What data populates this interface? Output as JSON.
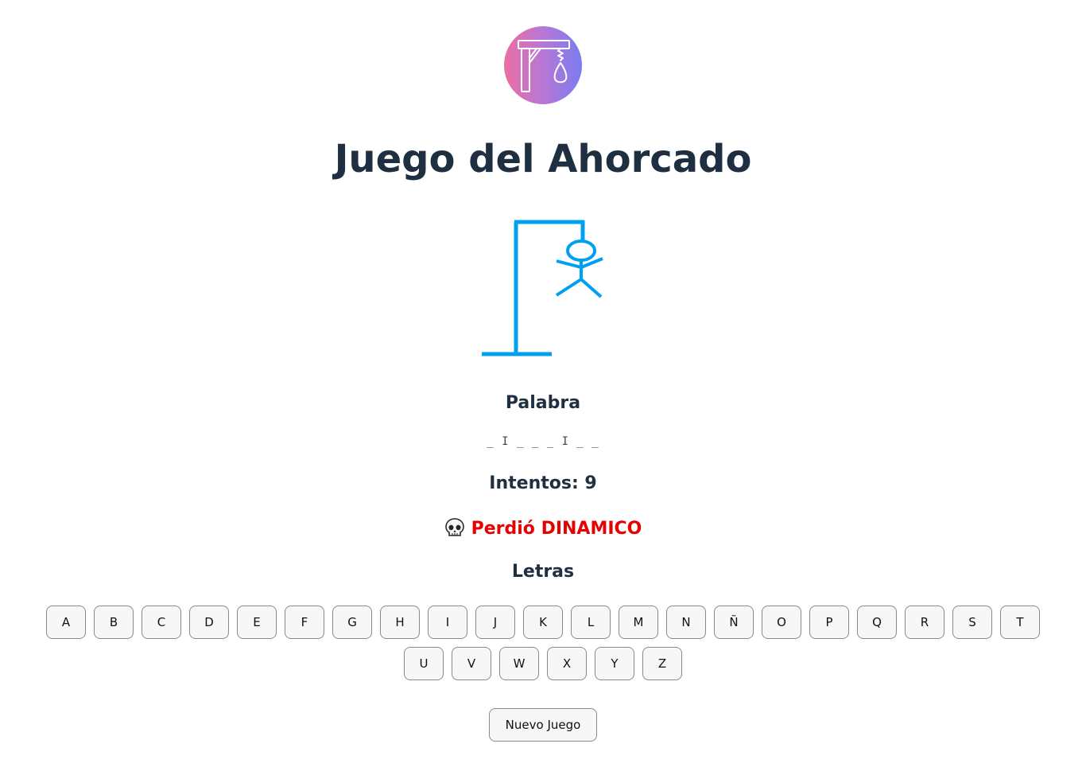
{
  "app": {
    "title": "Juego del Ahorcado",
    "logo_icon": "gallows-icon",
    "logo_gradient": [
      "#ec6ea4",
      "#7a7cf0"
    ]
  },
  "drawing": {
    "icon": "hangman-figure-icon",
    "color": "#00a0f0"
  },
  "word_section": {
    "label": "Palabra",
    "display": "_ I _ _ _ I _ _"
  },
  "attempts": {
    "label": "Intentos: 9"
  },
  "status": {
    "icon": "skull-icon",
    "text": "Perdió DINAMICO",
    "color": "#e60000"
  },
  "letters_section": {
    "label": "Letras",
    "rows": [
      [
        "A",
        "B",
        "C",
        "D",
        "E",
        "F",
        "G",
        "H",
        "I",
        "J",
        "K",
        "L",
        "M",
        "N",
        "Ñ",
        "O",
        "P",
        "Q",
        "R",
        "S",
        "T"
      ],
      [
        "U",
        "V",
        "W",
        "X",
        "Y",
        "Z"
      ]
    ]
  },
  "actions": {
    "new_game_label": "Nuevo Juego"
  }
}
